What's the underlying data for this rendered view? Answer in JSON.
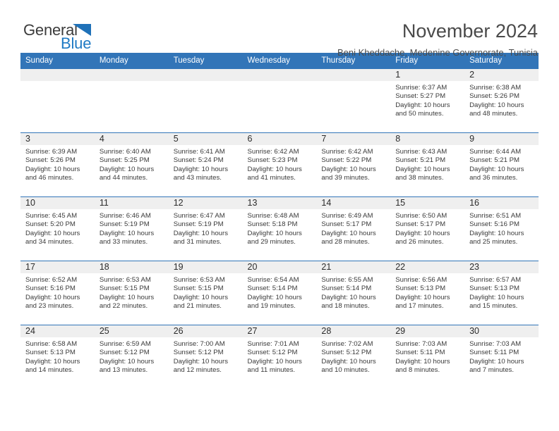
{
  "logo": {
    "word_top": "General",
    "word_bottom": "Blue",
    "triangle_color": "#1f71b8",
    "blue_text_color": "#1f7ac4"
  },
  "header": {
    "title": "November 2024",
    "subtitle": "Beni Kheddache, Medenine Governorate, Tunisia"
  },
  "theme": {
    "header_blue": "#3275b8",
    "daynum_band_gray": "#efefef",
    "text_color": "#3a3a3a"
  },
  "calendar": {
    "weekday_headers": [
      "Sunday",
      "Monday",
      "Tuesday",
      "Wednesday",
      "Thursday",
      "Friday",
      "Saturday"
    ],
    "weeks": [
      [
        {
          "day": "",
          "empty": true
        },
        {
          "day": "",
          "empty": true
        },
        {
          "day": "",
          "empty": true
        },
        {
          "day": "",
          "empty": true
        },
        {
          "day": "",
          "empty": true
        },
        {
          "day": "1",
          "sunrise": "Sunrise: 6:37 AM",
          "sunset": "Sunset: 5:27 PM",
          "daylight": "Daylight: 10 hours and 50 minutes."
        },
        {
          "day": "2",
          "sunrise": "Sunrise: 6:38 AM",
          "sunset": "Sunset: 5:26 PM",
          "daylight": "Daylight: 10 hours and 48 minutes."
        }
      ],
      [
        {
          "day": "3",
          "sunrise": "Sunrise: 6:39 AM",
          "sunset": "Sunset: 5:26 PM",
          "daylight": "Daylight: 10 hours and 46 minutes."
        },
        {
          "day": "4",
          "sunrise": "Sunrise: 6:40 AM",
          "sunset": "Sunset: 5:25 PM",
          "daylight": "Daylight: 10 hours and 44 minutes."
        },
        {
          "day": "5",
          "sunrise": "Sunrise: 6:41 AM",
          "sunset": "Sunset: 5:24 PM",
          "daylight": "Daylight: 10 hours and 43 minutes."
        },
        {
          "day": "6",
          "sunrise": "Sunrise: 6:42 AM",
          "sunset": "Sunset: 5:23 PM",
          "daylight": "Daylight: 10 hours and 41 minutes."
        },
        {
          "day": "7",
          "sunrise": "Sunrise: 6:42 AM",
          "sunset": "Sunset: 5:22 PM",
          "daylight": "Daylight: 10 hours and 39 minutes."
        },
        {
          "day": "8",
          "sunrise": "Sunrise: 6:43 AM",
          "sunset": "Sunset: 5:21 PM",
          "daylight": "Daylight: 10 hours and 38 minutes."
        },
        {
          "day": "9",
          "sunrise": "Sunrise: 6:44 AM",
          "sunset": "Sunset: 5:21 PM",
          "daylight": "Daylight: 10 hours and 36 minutes."
        }
      ],
      [
        {
          "day": "10",
          "sunrise": "Sunrise: 6:45 AM",
          "sunset": "Sunset: 5:20 PM",
          "daylight": "Daylight: 10 hours and 34 minutes."
        },
        {
          "day": "11",
          "sunrise": "Sunrise: 6:46 AM",
          "sunset": "Sunset: 5:19 PM",
          "daylight": "Daylight: 10 hours and 33 minutes."
        },
        {
          "day": "12",
          "sunrise": "Sunrise: 6:47 AM",
          "sunset": "Sunset: 5:19 PM",
          "daylight": "Daylight: 10 hours and 31 minutes."
        },
        {
          "day": "13",
          "sunrise": "Sunrise: 6:48 AM",
          "sunset": "Sunset: 5:18 PM",
          "daylight": "Daylight: 10 hours and 29 minutes."
        },
        {
          "day": "14",
          "sunrise": "Sunrise: 6:49 AM",
          "sunset": "Sunset: 5:17 PM",
          "daylight": "Daylight: 10 hours and 28 minutes."
        },
        {
          "day": "15",
          "sunrise": "Sunrise: 6:50 AM",
          "sunset": "Sunset: 5:17 PM",
          "daylight": "Daylight: 10 hours and 26 minutes."
        },
        {
          "day": "16",
          "sunrise": "Sunrise: 6:51 AM",
          "sunset": "Sunset: 5:16 PM",
          "daylight": "Daylight: 10 hours and 25 minutes."
        }
      ],
      [
        {
          "day": "17",
          "sunrise": "Sunrise: 6:52 AM",
          "sunset": "Sunset: 5:16 PM",
          "daylight": "Daylight: 10 hours and 23 minutes."
        },
        {
          "day": "18",
          "sunrise": "Sunrise: 6:53 AM",
          "sunset": "Sunset: 5:15 PM",
          "daylight": "Daylight: 10 hours and 22 minutes."
        },
        {
          "day": "19",
          "sunrise": "Sunrise: 6:53 AM",
          "sunset": "Sunset: 5:15 PM",
          "daylight": "Daylight: 10 hours and 21 minutes."
        },
        {
          "day": "20",
          "sunrise": "Sunrise: 6:54 AM",
          "sunset": "Sunset: 5:14 PM",
          "daylight": "Daylight: 10 hours and 19 minutes."
        },
        {
          "day": "21",
          "sunrise": "Sunrise: 6:55 AM",
          "sunset": "Sunset: 5:14 PM",
          "daylight": "Daylight: 10 hours and 18 minutes."
        },
        {
          "day": "22",
          "sunrise": "Sunrise: 6:56 AM",
          "sunset": "Sunset: 5:13 PM",
          "daylight": "Daylight: 10 hours and 17 minutes."
        },
        {
          "day": "23",
          "sunrise": "Sunrise: 6:57 AM",
          "sunset": "Sunset: 5:13 PM",
          "daylight": "Daylight: 10 hours and 15 minutes."
        }
      ],
      [
        {
          "day": "24",
          "sunrise": "Sunrise: 6:58 AM",
          "sunset": "Sunset: 5:13 PM",
          "daylight": "Daylight: 10 hours and 14 minutes."
        },
        {
          "day": "25",
          "sunrise": "Sunrise: 6:59 AM",
          "sunset": "Sunset: 5:12 PM",
          "daylight": "Daylight: 10 hours and 13 minutes."
        },
        {
          "day": "26",
          "sunrise": "Sunrise: 7:00 AM",
          "sunset": "Sunset: 5:12 PM",
          "daylight": "Daylight: 10 hours and 12 minutes."
        },
        {
          "day": "27",
          "sunrise": "Sunrise: 7:01 AM",
          "sunset": "Sunset: 5:12 PM",
          "daylight": "Daylight: 10 hours and 11 minutes."
        },
        {
          "day": "28",
          "sunrise": "Sunrise: 7:02 AM",
          "sunset": "Sunset: 5:12 PM",
          "daylight": "Daylight: 10 hours and 10 minutes."
        },
        {
          "day": "29",
          "sunrise": "Sunrise: 7:03 AM",
          "sunset": "Sunset: 5:11 PM",
          "daylight": "Daylight: 10 hours and 8 minutes."
        },
        {
          "day": "30",
          "sunrise": "Sunrise: 7:03 AM",
          "sunset": "Sunset: 5:11 PM",
          "daylight": "Daylight: 10 hours and 7 minutes."
        }
      ]
    ]
  }
}
